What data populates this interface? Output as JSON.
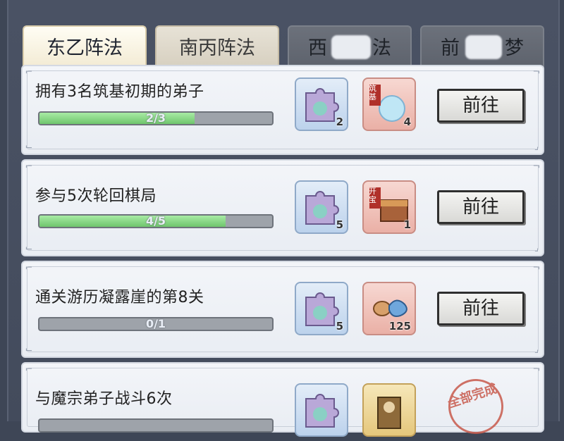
{
  "tabs": [
    {
      "label": "东乙阵法",
      "state": "active"
    },
    {
      "label": "南丙阵法",
      "state": "inactive"
    },
    {
      "label": "西",
      "label_tail": "法",
      "state": "locked"
    },
    {
      "label": "前",
      "label_tail": "梦",
      "state": "locked"
    }
  ],
  "tasks": [
    {
      "title": "拥有3名筑基初期的弟子",
      "progress_text": "2/3",
      "progress": 0.667,
      "rewards": [
        {
          "icon": "jigsaw-piece-icon",
          "count": "2"
        },
        {
          "icon": "spirit-orb-icon",
          "badge": "筑基",
          "count": "4"
        }
      ],
      "button": "前往"
    },
    {
      "title": "参与5次轮回棋局",
      "progress_text": "4/5",
      "progress": 0.8,
      "rewards": [
        {
          "icon": "jigsaw-piece-icon",
          "count": "5"
        },
        {
          "icon": "treasure-chest-icon",
          "badge": "开宝",
          "count": "1"
        }
      ],
      "button": "前往"
    },
    {
      "title": "通关游历凝露崖的第8关",
      "progress_text": "0/1",
      "progress": 0.0,
      "rewards": [
        {
          "icon": "jigsaw-piece-icon",
          "count": "5"
        },
        {
          "icon": "cloud-stone-icon",
          "count": "125"
        }
      ],
      "button": "前往"
    },
    {
      "title": "与魔宗弟子战斗6次",
      "progress_text": "",
      "progress": 0.0,
      "rewards": [
        {
          "icon": "jigsaw-piece-icon",
          "count": ""
        },
        {
          "icon": "warrior-card-icon",
          "count": ""
        }
      ],
      "stamp": "全部完成"
    }
  ],
  "colors": {
    "accent_green": "#6fc56d",
    "stamp_red": "#c85a4c",
    "panel": "#eef1f6"
  }
}
